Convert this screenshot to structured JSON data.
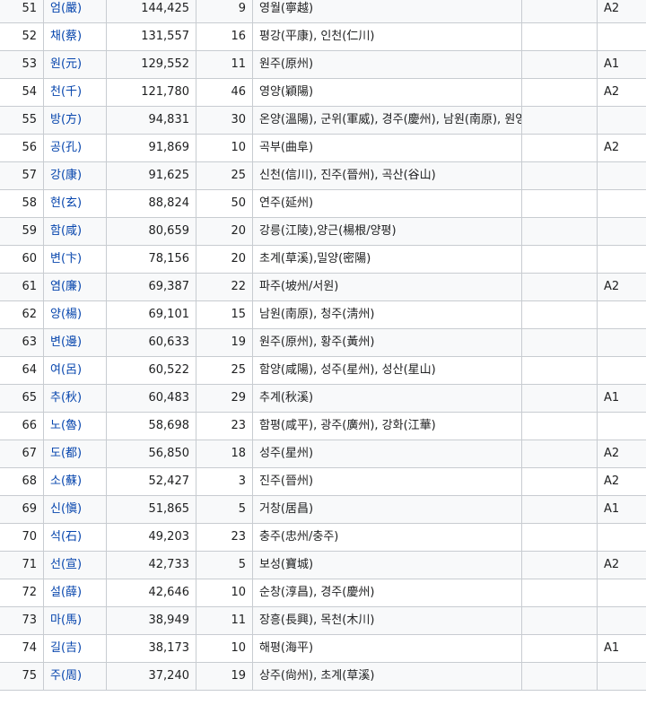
{
  "rows": [
    {
      "rank": "51",
      "name": "엄(嚴)",
      "population": "144,425",
      "clans": "9",
      "origin": "영월(寧越)",
      "grade": "A2"
    },
    {
      "rank": "52",
      "name": "채(蔡)",
      "population": "131,557",
      "clans": "16",
      "origin": "평강(平康), 인천(仁川)",
      "grade": ""
    },
    {
      "rank": "53",
      "name": "원(元)",
      "population": "129,552",
      "clans": "11",
      "origin": "원주(原州)",
      "grade": "A1"
    },
    {
      "rank": "54",
      "name": "천(千)",
      "population": "121,780",
      "clans": "46",
      "origin": "영양(穎陽)",
      "grade": "A2"
    },
    {
      "rank": "55",
      "name": "방(方)",
      "population": "94,831",
      "clans": "30",
      "origin": "온양(溫陽), 군위(軍威), 경주(慶州), 남원(南原), 원영(原榮)",
      "grade": ""
    },
    {
      "rank": "56",
      "name": "공(孔)",
      "population": "91,869",
      "clans": "10",
      "origin": "곡부(曲阜)",
      "grade": "A2"
    },
    {
      "rank": "57",
      "name": "강(康)",
      "population": "91,625",
      "clans": "25",
      "origin": "신천(信川), 진주(晉州), 곡산(谷山)",
      "grade": ""
    },
    {
      "rank": "58",
      "name": "현(玄)",
      "population": "88,824",
      "clans": "50",
      "origin": "연주(延州)",
      "grade": ""
    },
    {
      "rank": "59",
      "name": "함(咸)",
      "population": "80,659",
      "clans": "20",
      "origin": "강릉(江陵),양근(楊根/양평)",
      "grade": ""
    },
    {
      "rank": "60",
      "name": "변(卞)",
      "population": "78,156",
      "clans": "20",
      "origin": "초계(草溪),밀양(密陽)",
      "grade": ""
    },
    {
      "rank": "61",
      "name": "염(廉)",
      "population": "69,387",
      "clans": "22",
      "origin": "파주(坡州/서원)",
      "grade": "A2"
    },
    {
      "rank": "62",
      "name": "양(楊)",
      "population": "69,101",
      "clans": "15",
      "origin": "남원(南原), 청주(淸州)",
      "grade": ""
    },
    {
      "rank": "63",
      "name": "변(邊)",
      "population": "60,633",
      "clans": "19",
      "origin": "원주(原州), 황주(黃州)",
      "grade": ""
    },
    {
      "rank": "64",
      "name": "여(呂)",
      "population": "60,522",
      "clans": "25",
      "origin": "함양(咸陽), 성주(星州), 성산(星山)",
      "grade": ""
    },
    {
      "rank": "65",
      "name": "추(秋)",
      "population": "60,483",
      "clans": "29",
      "origin": "추계(秋溪)",
      "grade": "A1"
    },
    {
      "rank": "66",
      "name": "노(魯)",
      "population": "58,698",
      "clans": "23",
      "origin": "함평(咸平), 광주(廣州), 강화(江華)",
      "grade": ""
    },
    {
      "rank": "67",
      "name": "도(都)",
      "population": "56,850",
      "clans": "18",
      "origin": "성주(星州)",
      "grade": "A2"
    },
    {
      "rank": "68",
      "name": "소(蘇)",
      "population": "52,427",
      "clans": "3",
      "origin": "진주(晉州)",
      "grade": "A2"
    },
    {
      "rank": "69",
      "name": "신(愼)",
      "population": "51,865",
      "clans": "5",
      "origin": "거창(居昌)",
      "grade": "A1"
    },
    {
      "rank": "70",
      "name": "석(石)",
      "population": "49,203",
      "clans": "23",
      "origin": "충주(忠州/충주)",
      "grade": ""
    },
    {
      "rank": "71",
      "name": "선(宣)",
      "population": "42,733",
      "clans": "5",
      "origin": "보성(寶城)",
      "grade": "A2"
    },
    {
      "rank": "72",
      "name": "설(薛)",
      "population": "42,646",
      "clans": "10",
      "origin": "순창(淳昌), 경주(慶州)",
      "grade": ""
    },
    {
      "rank": "73",
      "name": "마(馬)",
      "population": "38,949",
      "clans": "11",
      "origin": "장흥(長興), 목천(木川)",
      "grade": ""
    },
    {
      "rank": "74",
      "name": "길(吉)",
      "population": "38,173",
      "clans": "10",
      "origin": "해평(海平)",
      "grade": "A1"
    },
    {
      "rank": "75",
      "name": "주(周)",
      "population": "37,240",
      "clans": "19",
      "origin": "상주(尙州), 초계(草溪)",
      "grade": ""
    }
  ]
}
